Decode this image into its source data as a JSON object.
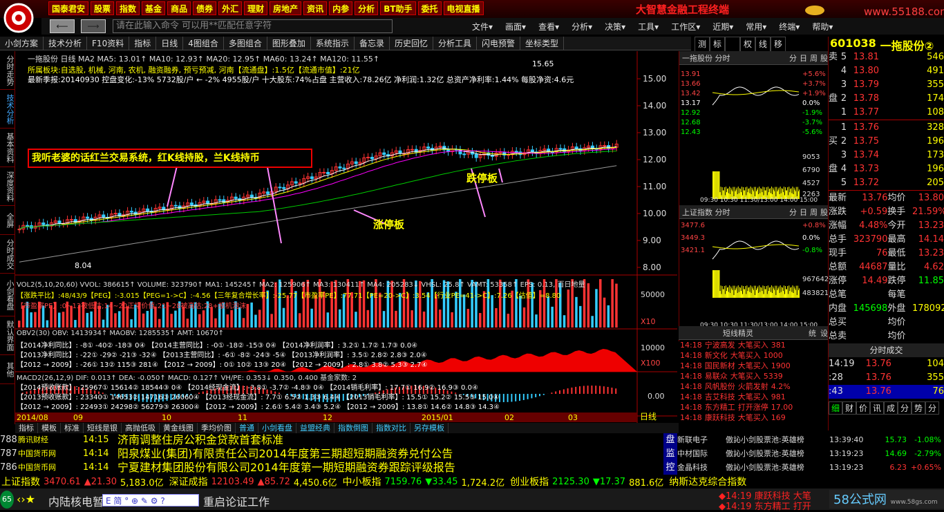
{
  "top": {
    "brand": "大智慧金融工程终端",
    "url": "www.55188.com",
    "menu": [
      "国泰君安",
      "股票",
      "指数",
      "基金",
      "商品",
      "债券",
      "外汇",
      "理财",
      "房地产",
      "资讯",
      "内参",
      "分析",
      "BT助手",
      "委托",
      "电视直播"
    ]
  },
  "cmd": {
    "placeholder": "请在此输入命令  可以用**匹配任意字符"
  },
  "menubar": [
    "文件▾",
    "画面▾",
    "查看▾",
    "分析▾",
    "决策▾",
    "工具▾",
    "工作区▾",
    "近期▾",
    "常用▾",
    "终端▾",
    "帮助▾"
  ],
  "toolbar": [
    "小剑方案",
    "技术分析",
    "F10资料",
    "指标",
    "日线",
    "4图组合",
    "多图组合",
    "图形叠加",
    "系统指示",
    "备忘录",
    "历史回忆",
    "分析工具",
    "闪电预警",
    "坐标类型"
  ],
  "rtoolbar": [
    "测",
    "标",
    "",
    "权",
    "线",
    "移"
  ],
  "leftrail": [
    "分时走势",
    "技术分析",
    "基本资料",
    "深度资料",
    "全屏",
    "分时成交",
    "小剑看盘",
    "默认界面",
    "其他"
  ],
  "chart": {
    "info1": "一拖股份 日线  MA2 MA5: 13.01↑  MA10: 12.93↑  MA20: 12.95↑  MA60: 13.24↑  MA120: 11.55↑",
    "info2": "所属板块:自选股, 机械, 河南, 农机, 融资融券, 预亏预减, 河南【流通盘】:1.5亿【流通市值】:21亿",
    "info3": "最新季报:20140930 控盘变化:-13% 5732股/户 ← -2% 4955股/户 十大股东:74%占盘 主营收入:78.26亿 净利润:1.32亿 总资产净利率:1.44% 每股净资:4.6元",
    "hi": "15.65",
    "lo": "8.04",
    "price_ticks": [
      "15.00",
      "14.00",
      "13.00",
      "12.00",
      "11.00",
      "10.00",
      "9.00",
      "8.00"
    ],
    "annot": "我听老婆的话红兰交易系统，红K线持股，兰K线持币",
    "zt": "涨停板",
    "dt": "跌停板",
    "vol_label": "VOL2(5,10,20,60)  VVOL: 386615↑  VOLUME: 323790↑  MA1: 145245↑  MA2: 125906↑  MA3: 130411↑  MA4: 205283↓  VHSL: 25.8↑  VAMT: 53358↑  EPS: 0.13, 百日地量",
    "vol_line2": "【涨跌平比】:48/43/9【PEG】:-3.015【PEG=1->C】:-4.56【三年复合增长率】:-25.77【市盈率PE】:77.71【PE=20->C】:3.54【行业PE=41->C】:7.26【估值】=8.80",
    "vol_line3": "【市盈率PE】:0~13被低估;14~20正常价值;21~28被高估;28+投机泡沫",
    "vol_ticks": [
      "50000",
      "10000"
    ],
    "x10": "X10",
    "x100": "X100",
    "obv_label": "OBV2(30)  OBV: 1413934↑  MAOBV: 1285535↑  AMT: 10670↑",
    "obv_rows": [
      "【2014净利同比】:    -8①    -40②    -18③    0④ 【2014主营同比】:   -0①   -18②   -15③   0④ 【2014净利润率】:   3.2①   1.7②   1.7③   0.0④",
      "【2013净利同比】:   -22①    -29②    -21③   -32④ 【2013主营同比】:   -6①    -8②   -24③  -5④ 【2013净利润率】:   3.5①   2.8②   2.8③   2.0④",
      "【2012 → 2009】:   -26①    13②    115③   281④ 【2012 → 2009】:    0①    10②    13③   20④ 【2012 → 2009】:   2.8①   3.8②   5.3③   2.7④"
    ],
    "macd_label": "MACD2(26,12,9)  DIF: 0.013↑  DEA: -0.050↑  MACD: 0.127↑  VH/PE: 0.353↓  0.350, 0.400  基金家数: 2",
    "macd_rows": [
      "【2014预收账款】:  25967①  15614②  18544③   0④ 【2014经现金流】:  -3.8①  -3.7②  -4.8③  0④ 【2014销毛利率】:  17.7①  16.9②  16.9③  0.0④",
      "【2013预收账款】:  23340①  14653②  14716③  26060④ 【2013经现金流】:   7.7①   6.5②   1.3③  6.4④ 【2013销毛利率】:  15.5①  15.2②  15.5③  15.0④",
      "【2012 → 2009】:  22493①  24298②  56279③  26300④ 【2012 → 2009】:   2.6①   5.4②   3.4③  5.2④ 【2012 → 2009】:  13.8①  14.6②  14.8③  14.3④"
    ],
    "macd_ticks": [
      "0.00"
    ],
    "dates": [
      "2014/08",
      "09",
      "10",
      "11",
      "12",
      "2015/01",
      "02",
      "03"
    ],
    "period": "日线"
  },
  "bottomtabs": [
    "指标",
    "模板",
    "标准",
    "短线是银",
    "高抛低吸",
    "黄金线图",
    "季均价图",
    "普通",
    "小剑看盘",
    "益盟经典",
    "指数倒图",
    "指数对比",
    "另存模板"
  ],
  "mini1": {
    "title": "一拖股份 分时",
    "tabs": [
      "分",
      "日",
      "周",
      "股"
    ],
    "prices": [
      "13.91",
      "13.66",
      "13.42",
      "13.17",
      "12.92",
      "12.68",
      "12.43"
    ],
    "pcts": [
      "+5.6%",
      "+3.7%",
      "+1.9%",
      "0.0%",
      "-1.9%",
      "-3.7%",
      "-5.6%"
    ],
    "vols": [
      "9053",
      "6790",
      "4527",
      "2263"
    ],
    "times": "09:30 10:30 11:30/13:00 14:00 15:00"
  },
  "mini2": {
    "title": "上证指数 分时",
    "tabs": [
      "分",
      "日",
      "周",
      "股"
    ],
    "prices": [
      "3477.6",
      "3449.3",
      "3421.1"
    ],
    "pcts": [
      "+0.8%",
      "0.0%",
      "-0.8%"
    ],
    "vols": [
      "967642",
      "483821"
    ],
    "times": "09:30 10:30 11:30/13:00 14:00 15:00"
  },
  "shortspirit": {
    "title": "短线精灵",
    "tabs": [
      "统",
      "设"
    ],
    "rows": [
      [
        "14:18",
        "宁波高发",
        "大笔买入",
        "381"
      ],
      [
        "14:18",
        "新文化",
        "大笔买入",
        "1000"
      ],
      [
        "14:18",
        "国民新材",
        "大笔买入",
        "1900"
      ],
      [
        "14:18",
        "易联众",
        "大笔买入",
        "5339"
      ],
      [
        "14:18",
        "风帆股份",
        "火箭发射",
        "4.2%"
      ],
      [
        "14:18",
        "吉艾科技",
        "大笔买入",
        "981"
      ],
      [
        "14:18",
        "东方精工",
        "打开涨停",
        "17.00"
      ],
      [
        "14:18",
        "康跃科技",
        "大笔买入",
        "169"
      ]
    ]
  },
  "quote": {
    "code": "601038",
    "name": "一拖股份②",
    "sell": [
      [
        "卖",
        "5",
        "13.81",
        "546"
      ],
      [
        "",
        "4",
        "13.80",
        "491"
      ],
      [
        "",
        "3",
        "13.79",
        "355"
      ],
      [
        "盘",
        "2",
        "13.78",
        "174"
      ],
      [
        "",
        "1",
        "13.77",
        "108"
      ]
    ],
    "buy": [
      [
        "",
        "1",
        "13.76",
        "328"
      ],
      [
        "买",
        "2",
        "13.75",
        "196"
      ],
      [
        "",
        "3",
        "13.74",
        "173"
      ],
      [
        "盘",
        "4",
        "13.73",
        "196"
      ],
      [
        "",
        "5",
        "13.72",
        "205"
      ]
    ],
    "stats": [
      [
        "最新",
        "13.76",
        "均价",
        "13.80"
      ],
      [
        "涨跌",
        "+0.59",
        "换手",
        "21.59%"
      ],
      [
        "涨幅",
        "4.48%",
        "今开",
        "13.23"
      ],
      [
        "总手",
        "323790",
        "最高",
        "14.14"
      ],
      [
        "现手",
        "76",
        "最低",
        "13.23"
      ],
      [
        "总额",
        "44687",
        "量比",
        "4.62"
      ],
      [
        "涨停",
        "14.49",
        "跌停",
        "11.85"
      ],
      [
        "总笔",
        "",
        "每笔",
        ""
      ],
      [
        "内盘",
        "145698",
        "外盘",
        "178092"
      ],
      [
        "总买",
        "",
        "均价",
        ""
      ],
      [
        "总卖",
        "",
        "均价",
        ""
      ]
    ],
    "tick_title": "分时成交",
    "ticks": [
      [
        "14:19",
        "13.76",
        "104"
      ],
      [
        ":28",
        "13.76",
        "355"
      ],
      [
        ":43",
        "13.76",
        "76"
      ]
    ],
    "tabs": [
      "细",
      "财",
      "价",
      "讯",
      "成",
      "分",
      "势",
      "分"
    ]
  },
  "news": [
    [
      "788",
      "腾讯财经",
      "14:15",
      "济南调整住房公积金贷款首套标准"
    ],
    [
      "787",
      "中国货币网",
      "14:14",
      "阳泉煤业(集团)有限责任公司2014年度第三期超短期融资券兑付公告"
    ],
    [
      "786",
      "中国货币网",
      "14:14",
      "宁夏建材集团股份有限公司2014年度第一期短期融资券跟踪评级报告"
    ]
  ],
  "alerts": [
    [
      "新联电子",
      "傲訫小剑股票池:英雄榜",
      "13:39:40",
      "15.73",
      "-1.08%"
    ],
    [
      "中材国际",
      "傲訫小剑股票池:英雄榜",
      "13:19:23",
      "14.69",
      "-2.79%"
    ],
    [
      "金晶科技",
      "傲訫小剑股票池:英雄榜",
      "13:19:23",
      "6.23",
      "+0.65%"
    ]
  ],
  "alert_side": [
    "盘",
    "监",
    "控"
  ],
  "indices": [
    {
      "name": "上证指数",
      "val": "3470.61",
      "chg": "▲21.30",
      "amt": "5,183.0亿"
    },
    {
      "name": "深证成指",
      "val": "12103.49",
      "chg": "▲85.72",
      "amt": "4,450.6亿"
    },
    {
      "name": "中小板指",
      "val": "7159.76",
      "chg": "▼33.45",
      "amt": "1,724.2亿"
    },
    {
      "name": "创业板指",
      "val": "2125.30",
      "chg": "▼17.37",
      "amt": "881.6亿"
    },
    {
      "name": "纳斯达克综合指数",
      "val": "",
      "chg": "",
      "amt": ""
    }
  ],
  "status": {
    "scroll": "内陆核电暂",
    "scroll2": "重启论证工作",
    "ticker": "◆14:19 康跃科技 大笔",
    "ticker2": "◆14:19 东方精工 打开",
    "site": "58公式网",
    "site2": "www.58gs.com",
    "badge": "65"
  }
}
